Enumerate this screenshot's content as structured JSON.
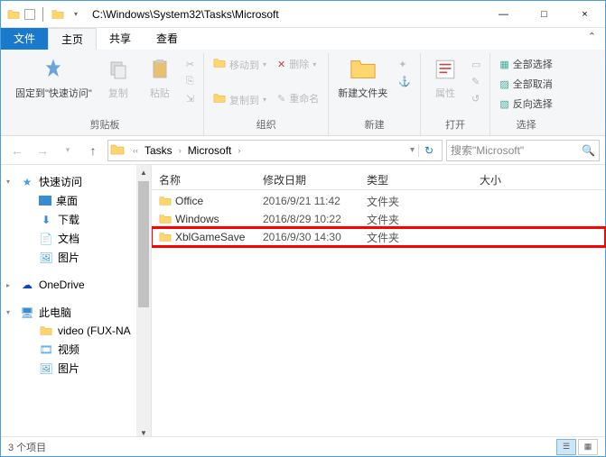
{
  "window": {
    "title": "C:\\Windows\\System32\\Tasks\\Microsoft",
    "minimize": "—",
    "maximize": "□",
    "close": "×"
  },
  "tabs": {
    "file": "文件",
    "home": "主页",
    "share": "共享",
    "view": "查看"
  },
  "ribbon": {
    "clipboard": {
      "label": "剪贴板",
      "pin": "固定到\"快速访问\"",
      "copy": "复制",
      "paste": "粘贴"
    },
    "organize": {
      "label": "组织",
      "moveto": "移动到",
      "copyto": "复制到",
      "delete": "删除",
      "rename": "重命名"
    },
    "new": {
      "label": "新建",
      "newfolder": "新建文件夹"
    },
    "open": {
      "label": "打开",
      "properties": "属性"
    },
    "select": {
      "label": "选择",
      "selectall": "全部选择",
      "selectnone": "全部取消",
      "invert": "反向选择"
    }
  },
  "breadcrumb": {
    "items": [
      "Tasks",
      "Microsoft"
    ],
    "refresh": "↻"
  },
  "search": {
    "placeholder": "搜索\"Microsoft\""
  },
  "navpane": {
    "quickaccess": "快速访问",
    "desktop": "桌面",
    "downloads": "下载",
    "documents": "文档",
    "pictures": "图片",
    "onedrive": "OneDrive",
    "thispc": "此电脑",
    "video_net": "video (FUX-NA",
    "videos": "视频",
    "pictures2": "图片"
  },
  "columns": {
    "name": "名称",
    "date": "修改日期",
    "type": "类型",
    "size": "大小"
  },
  "files": [
    {
      "name": "Office",
      "date": "2016/9/21 11:42",
      "type": "文件夹",
      "highlighted": false
    },
    {
      "name": "Windows",
      "date": "2016/8/29 10:22",
      "type": "文件夹",
      "highlighted": false
    },
    {
      "name": "XblGameSave",
      "date": "2016/9/30 14:30",
      "type": "文件夹",
      "highlighted": true
    }
  ],
  "status": {
    "count": "3 个项目"
  }
}
